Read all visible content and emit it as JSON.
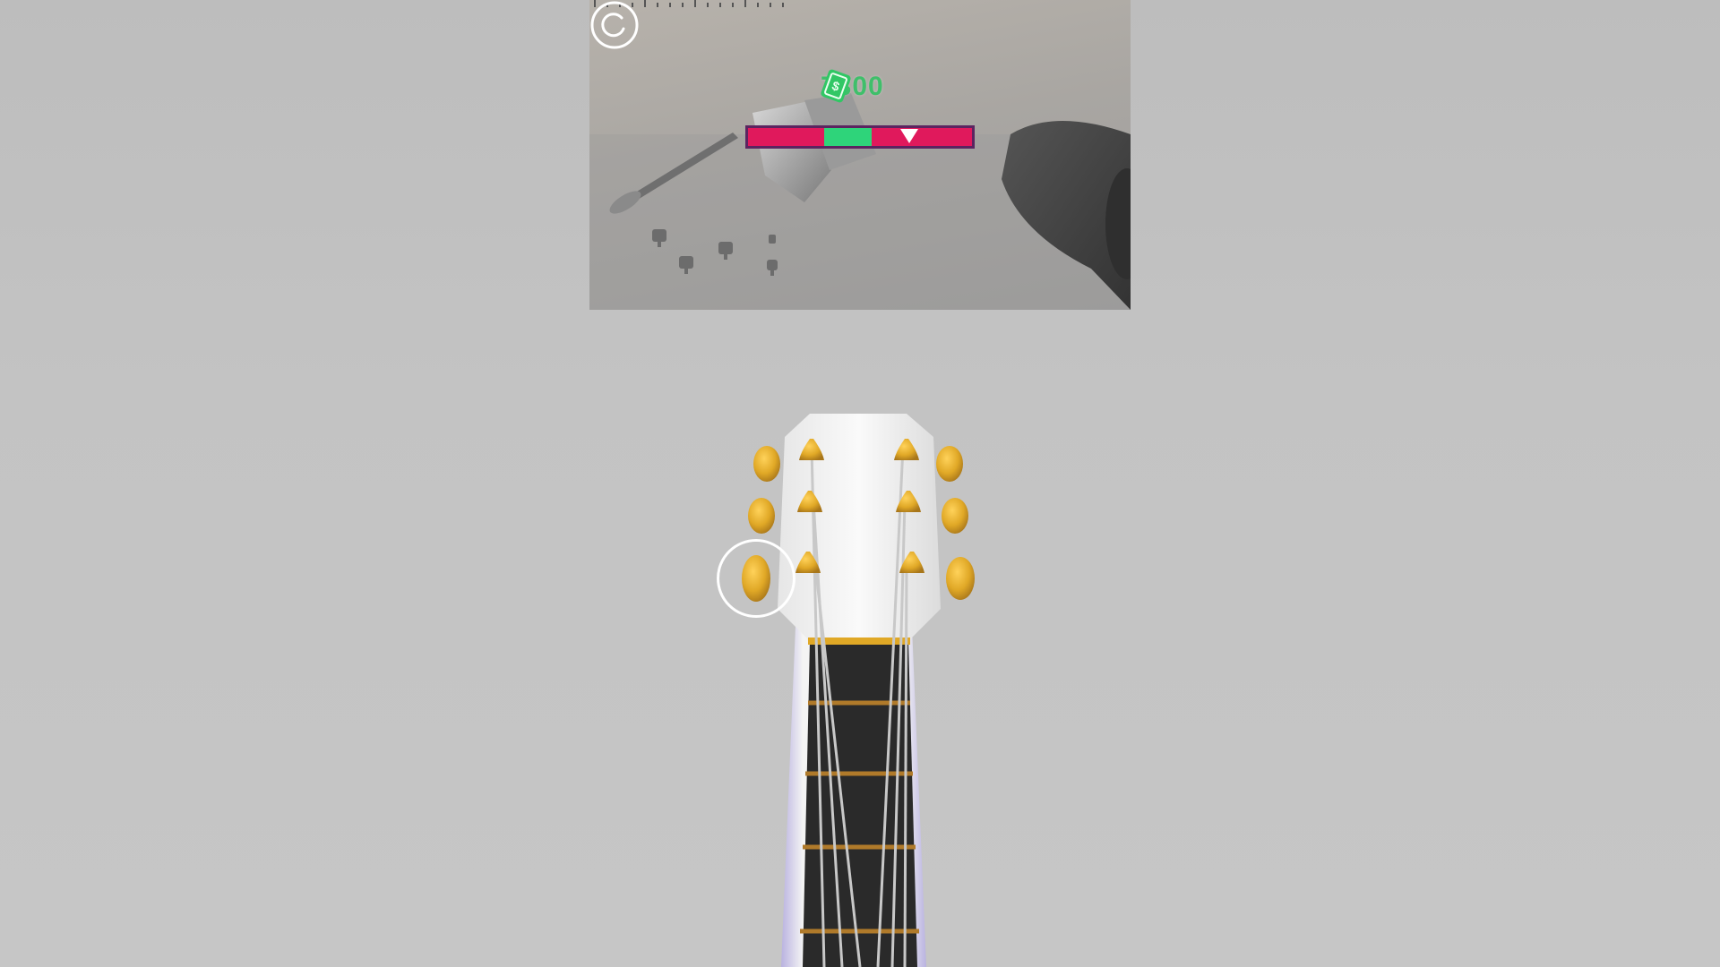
{
  "hud": {
    "cash_amount": "7300",
    "cash_icon": "money-bill-icon",
    "restart_icon": "restart-icon"
  },
  "tuner": {
    "needle_position": 0.72,
    "target_zone": [
      0.34,
      0.55
    ],
    "colors": {
      "bar": "#e0195c",
      "zone": "#2ed47a",
      "border": "#5b2460",
      "needle": "#ffffff"
    }
  },
  "guitar": {
    "tuning_pegs": [
      "peg-left-1",
      "peg-left-2",
      "peg-left-3",
      "peg-right-1",
      "peg-right-2",
      "peg-right-3"
    ],
    "selected_peg": "peg-left-3",
    "peg_color": "#e8b030",
    "string_count": 6
  }
}
